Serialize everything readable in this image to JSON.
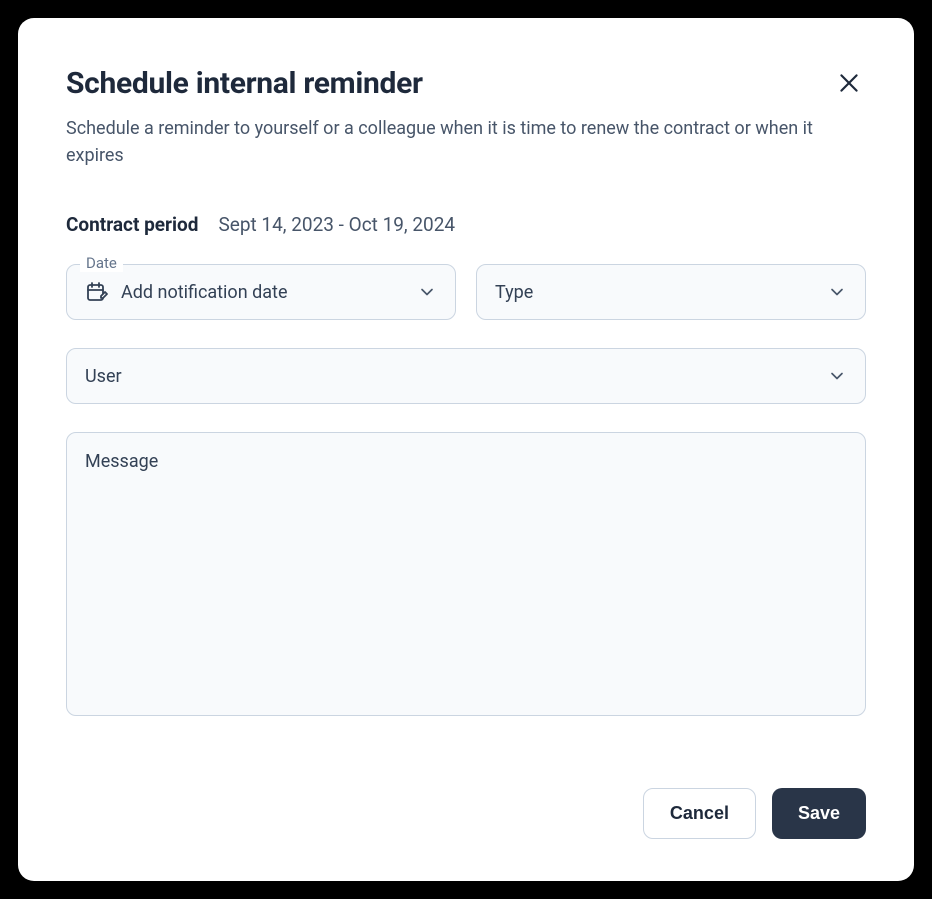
{
  "modal": {
    "title": "Schedule internal reminder",
    "description": "Schedule a reminder to yourself or a colleague when it is time to renew the contract or when it expires",
    "contract_period_label": "Contract period",
    "contract_period_value": "Sept 14, 2023 - Oct 19, 2024",
    "fields": {
      "date": {
        "floating_label": "Date",
        "placeholder": "Add notification date"
      },
      "type": {
        "placeholder": "Type"
      },
      "user": {
        "placeholder": "User"
      },
      "message": {
        "placeholder": "Message"
      }
    },
    "buttons": {
      "cancel": "Cancel",
      "save": "Save"
    }
  }
}
